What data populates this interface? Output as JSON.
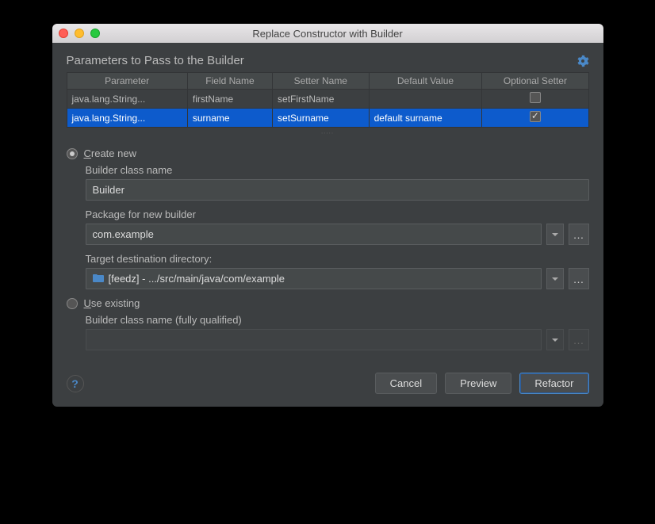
{
  "window": {
    "title": "Replace Constructor with Builder"
  },
  "section": {
    "title": "Parameters to Pass to the Builder"
  },
  "columns": {
    "parameter": "Parameter",
    "field_name": "Field Name",
    "setter_name": "Setter Name",
    "default_value": "Default Value",
    "optional_setter": "Optional Setter"
  },
  "rows": [
    {
      "parameter": "java.lang.String...",
      "field_name": "firstName",
      "setter_name": "setFirstName",
      "default_value": "",
      "optional": false
    },
    {
      "parameter": "java.lang.String...",
      "field_name": "surname",
      "setter_name": "setSurname",
      "default_value": "default surname",
      "optional": true,
      "selected": true
    }
  ],
  "options": {
    "create_new": {
      "label_pre": "C",
      "label_rest": "reate new",
      "selected": true
    },
    "use_existing": {
      "label_pre": "U",
      "label_rest": "se existing",
      "selected": false
    }
  },
  "fields": {
    "builder_class_name_label": "Builder class name",
    "builder_class_name_value": "Builder",
    "package_label": "Package for new builder",
    "package_value": "com.example",
    "target_dir_label": "Target destination directory:",
    "target_dir_value": "[feedz] - .../src/main/java/com/example",
    "existing_label": "Builder class name (fully qualified)",
    "existing_value": ""
  },
  "buttons": {
    "cancel": "Cancel",
    "preview": "Preview",
    "refactor": "Refactor"
  }
}
